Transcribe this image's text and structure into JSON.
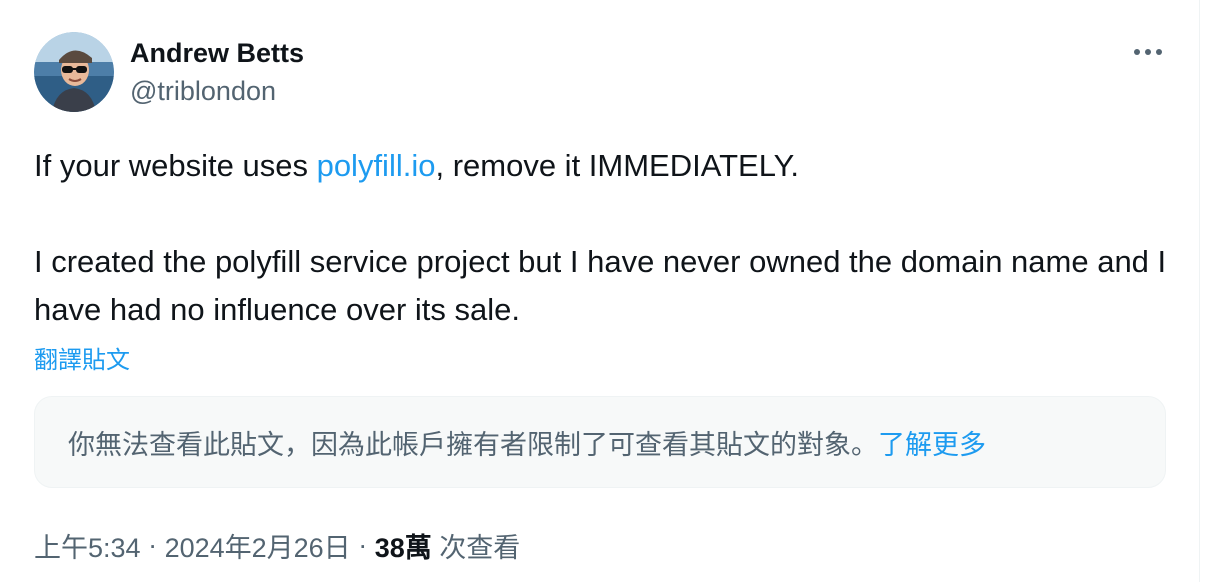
{
  "author": {
    "display_name": "Andrew Betts",
    "handle": "@triblondon",
    "avatar_icon": "avatar-photo-icon"
  },
  "more_icon": "more-horizontal-icon",
  "tweet": {
    "text_before_link": "If your website uses ",
    "link_text": "polyfill.io",
    "text_after_link": ", remove it IMMEDIATELY.\n\nI created the polyfill service project but I have never owned the domain name and I have had no influence over its sale.",
    "translate_label": "翻譯貼文"
  },
  "notice": {
    "message": "你無法查看此貼文，因為此帳戶擁有者限制了可查看其貼文的對象。",
    "learn_more": "了解更多"
  },
  "meta": {
    "time": "上午5:34",
    "separator": " · ",
    "date": "2024年2月26日",
    "views_count": "38萬",
    "views_label": " 次查看"
  },
  "colors": {
    "accent": "#1d9bf0",
    "text_primary": "#0f1419",
    "text_secondary": "#536471",
    "notice_bg": "#f7f9f9"
  }
}
